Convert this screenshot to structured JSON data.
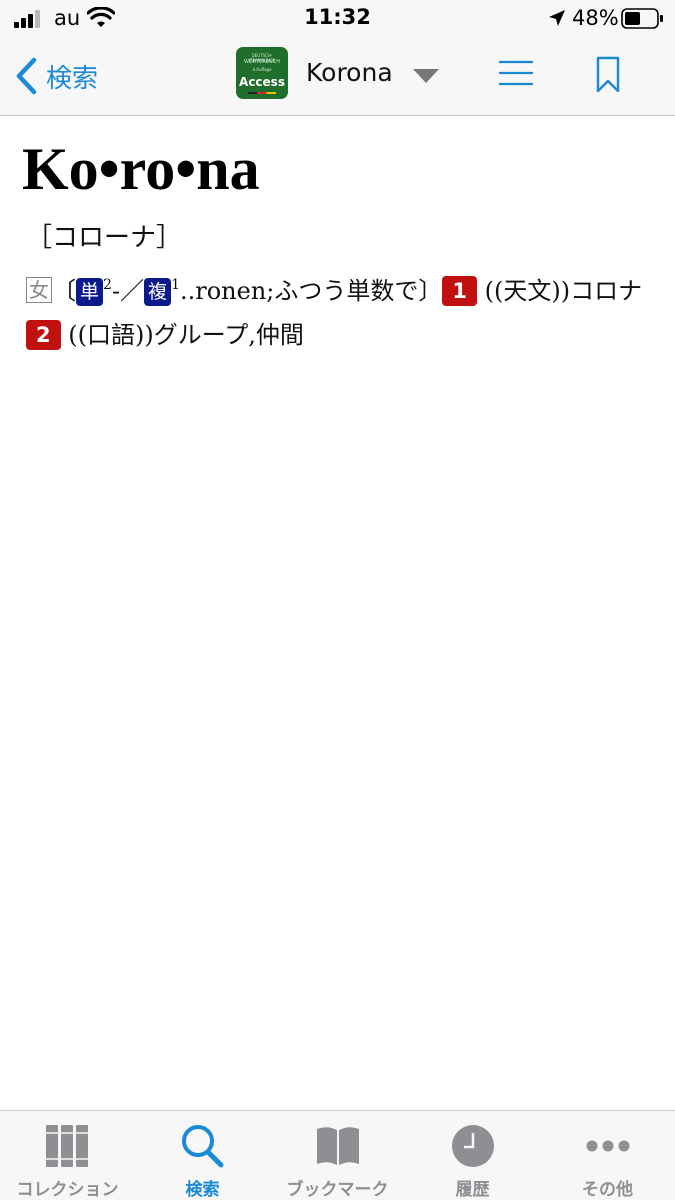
{
  "status_bar": {
    "carrier": "au",
    "time": "11:32",
    "battery": "48%"
  },
  "nav": {
    "back_label": "検索",
    "app_icon": {
      "small_text": [
        "DEUTSCH-JAPANISCHES",
        "WÖRTERBUCH",
        "4.Auflage"
      ],
      "name": "Access"
    },
    "dictionary_title": "Korona",
    "icons": [
      "chevron-left-icon",
      "dropdown-triangle-icon",
      "menu-lines-icon",
      "bookmark-icon"
    ]
  },
  "entry": {
    "headword": "Ko•ro•na",
    "pronunciation": "［コローナ］",
    "gender": "女",
    "bracket_open": "〔",
    "singular_tag": "単",
    "singular_sup": "2",
    "singular_suffix": "-",
    "separator": "／",
    "plural_tag": "複",
    "plural_sup": "1",
    "plural_text": "..ronen;ふつう単数で",
    "bracket_close": "〕",
    "senses": [
      {
        "number": "1",
        "text": "((天文))コロナ"
      },
      {
        "number": "2",
        "text": "((口語))グループ,仲間"
      }
    ]
  },
  "tab_bar": {
    "tabs": [
      {
        "label": "コレクション",
        "icon": "collection-books-icon"
      },
      {
        "label": "検索",
        "icon": "search-icon",
        "active": true
      },
      {
        "label": "ブックマーク",
        "icon": "open-book-icon"
      },
      {
        "label": "履歴",
        "icon": "clock-icon"
      },
      {
        "label": "その他",
        "icon": "more-dots-icon"
      }
    ]
  },
  "colors": {
    "accent": "#1a8ad6",
    "tag_blue": "#0d1a8c",
    "tag_red": "#c0100f",
    "inactive": "#8e8e93"
  }
}
